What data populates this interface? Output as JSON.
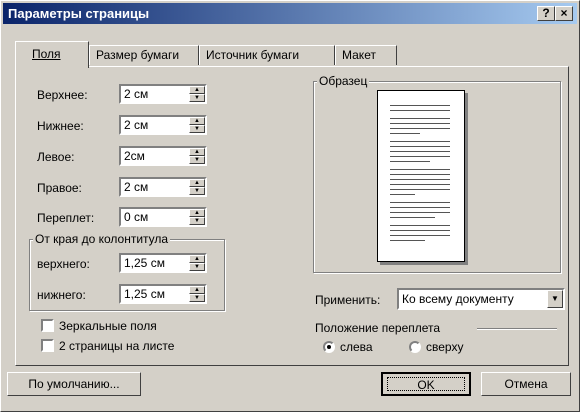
{
  "window": {
    "title": "Параметры страницы"
  },
  "titlebar_buttons": {
    "help": "?",
    "close": "×"
  },
  "tabs": [
    {
      "label": "Поля",
      "active": true
    },
    {
      "label": "Размер бумаги",
      "active": false
    },
    {
      "label": "Источник бумаги",
      "active": false
    },
    {
      "label": "Макет",
      "active": false
    }
  ],
  "margins": {
    "top": {
      "label": "Верхнее:",
      "value": "2 см"
    },
    "bottom": {
      "label": "Нижнее:",
      "value": "2 см"
    },
    "left": {
      "label": "Левое:",
      "value": "2см"
    },
    "right": {
      "label": "Правое:",
      "value": "2 см"
    },
    "gutter": {
      "label": "Переплет:",
      "value": "0 см"
    }
  },
  "header_footer_group": {
    "title": "От края до колонтитула",
    "header": {
      "label": "верхнего:",
      "value": "1,25 см"
    },
    "footer": {
      "label": "нижнего:",
      "value": "1,25 см"
    }
  },
  "checkboxes": {
    "mirror": {
      "label": "Зеркальные поля",
      "checked": false
    },
    "two_pages": {
      "label": "2 страницы на листе",
      "checked": false
    }
  },
  "preview": {
    "title": "Образец"
  },
  "apply": {
    "label": "Применить:",
    "value": "Ко всему документу"
  },
  "gutter_position": {
    "title": "Положение переплета",
    "left": {
      "label": "слева",
      "selected": true
    },
    "top": {
      "label": "сверху",
      "selected": false
    }
  },
  "buttons": {
    "default": "По умолчанию...",
    "ok": "OK",
    "cancel": "Отмена"
  }
}
